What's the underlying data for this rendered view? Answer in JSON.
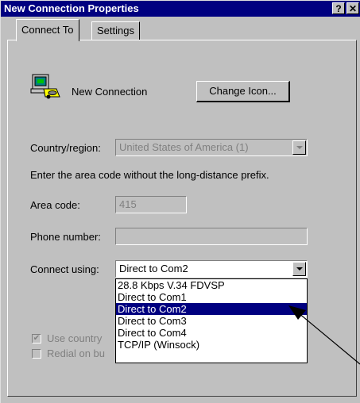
{
  "window": {
    "title": "New Connection Properties",
    "help_glyph": "?",
    "close_glyph": "✕"
  },
  "tabs": [
    {
      "label": "Connect To",
      "active": true
    },
    {
      "label": "Settings",
      "active": false
    }
  ],
  "connection": {
    "name": "New Connection",
    "change_icon_label": "Change Icon..."
  },
  "country": {
    "label": "Country/region:",
    "value": "United States of America (1)"
  },
  "instruction": "Enter the area code without the long-distance prefix.",
  "area_code": {
    "label": "Area code:",
    "value": "415"
  },
  "phone": {
    "label": "Phone number:",
    "value": ""
  },
  "connect_using": {
    "label": "Connect using:",
    "selected": "Direct to Com2",
    "options": [
      "28.8 Kbps V.34 FDVSP",
      "Direct to Com1",
      "Direct to Com2",
      "Direct to Com3",
      "Direct to Com4",
      "TCP/IP (Winsock)"
    ],
    "highlighted_index": 2
  },
  "checkboxes": {
    "use_country_partial": "Use country",
    "redial_partial": "Redial on bu"
  },
  "colors": {
    "titlebar": "#000080",
    "face": "#c0c0c0",
    "highlight": "#000080"
  }
}
